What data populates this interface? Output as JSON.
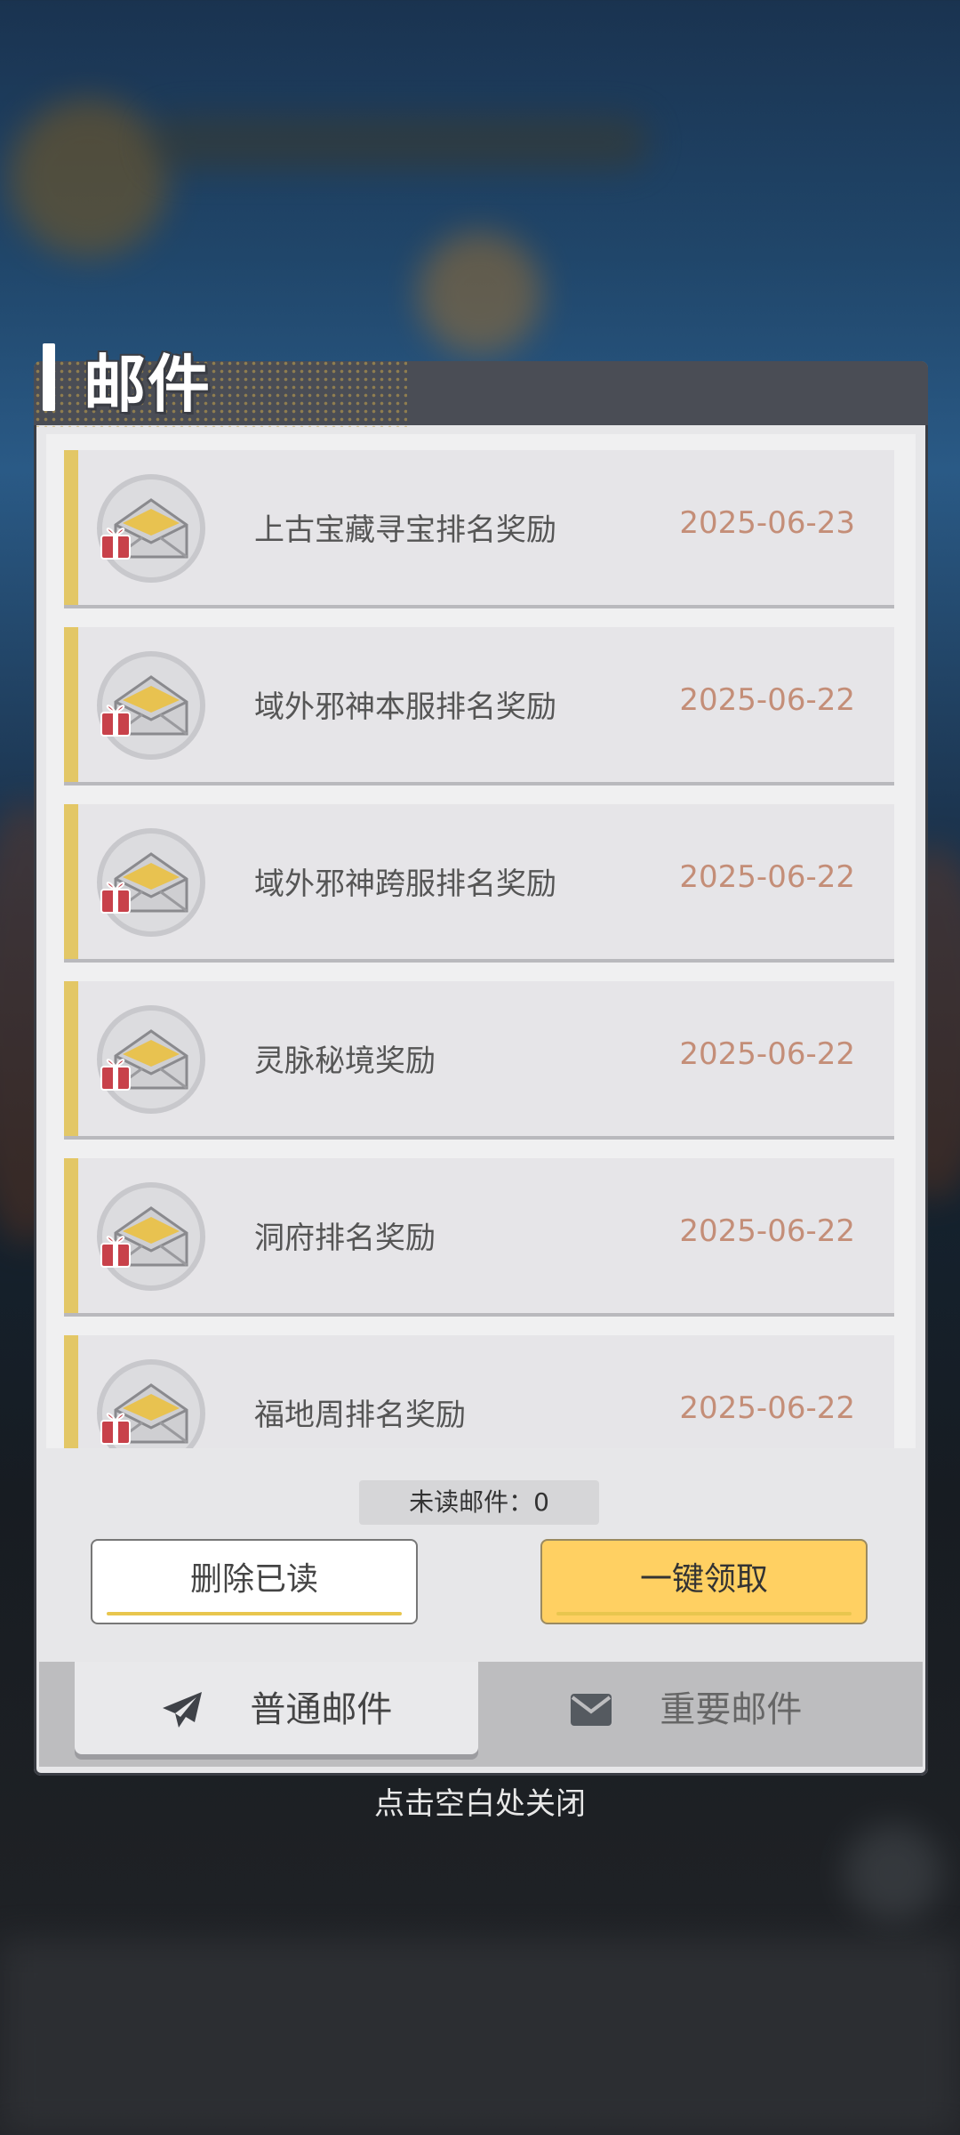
{
  "panel": {
    "title": "邮件"
  },
  "mails": [
    {
      "title": "上古宝藏寻宝排名奖励",
      "date": "2025-06-23"
    },
    {
      "title": "域外邪神本服排名奖励",
      "date": "2025-06-22"
    },
    {
      "title": "域外邪神跨服排名奖励",
      "date": "2025-06-22"
    },
    {
      "title": "灵脉秘境奖励",
      "date": "2025-06-22"
    },
    {
      "title": "洞府排名奖励",
      "date": "2025-06-22"
    },
    {
      "title": "福地周排名奖励",
      "date": "2025-06-22"
    }
  ],
  "footer": {
    "unread_label": "未读邮件：0",
    "delete_read": "删除已读",
    "claim_all": "一键领取"
  },
  "tabs": {
    "normal": "普通邮件",
    "important": "重要邮件"
  },
  "close_hint": "点击空白处关闭",
  "colors": {
    "accent_yellow": "#e3c766",
    "claim_button": "#ffd062",
    "date_text": "#c48e78"
  },
  "icons": {
    "mail_item": "envelope-gift-icon",
    "tab_normal": "paper-plane-icon",
    "tab_important": "envelope-icon"
  }
}
